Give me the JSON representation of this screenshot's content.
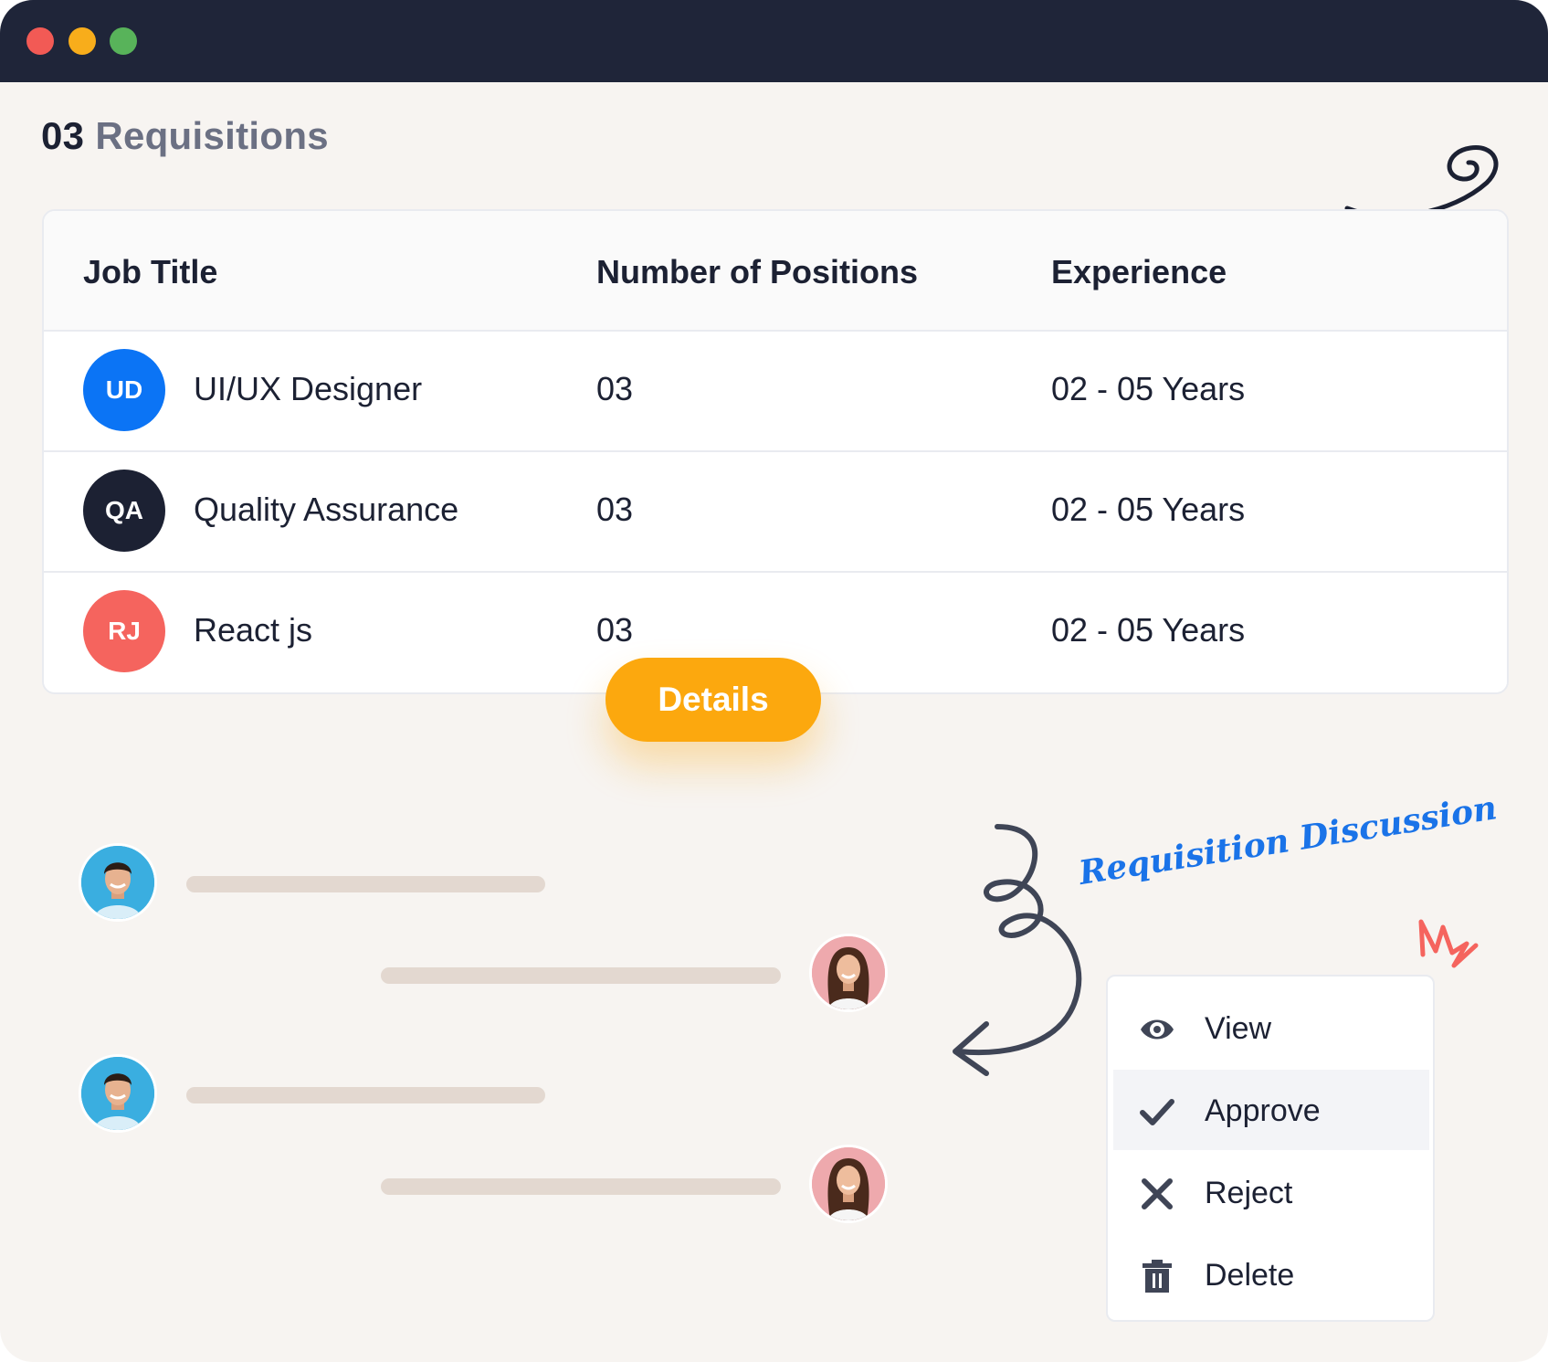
{
  "window": {
    "controls": [
      "close",
      "minimize",
      "maximize"
    ]
  },
  "page": {
    "count": "03",
    "title": "Requisitions"
  },
  "table": {
    "columns": [
      "Job Title",
      "Number of Positions",
      "Experience"
    ],
    "rows": [
      {
        "initials": "UD",
        "badge_color": "#0b74f5",
        "title": "UI/UX Designer",
        "positions": "03",
        "experience": "02 - 05 Years"
      },
      {
        "initials": "QA",
        "badge_color": "#1c2133",
        "title": "Quality Assurance",
        "positions": "03",
        "experience": "02 - 05 Years"
      },
      {
        "initials": "RJ",
        "badge_color": "#f5645e",
        "title": "React js",
        "positions": "03",
        "experience": "02 - 05 Years"
      }
    ]
  },
  "details_button": {
    "label": "Details",
    "color": "#fca80e"
  },
  "discussion": {
    "label": "Requisition Discussion"
  },
  "action_menu": {
    "items": [
      {
        "label": "View",
        "icon": "eye-icon"
      },
      {
        "label": "Approve",
        "icon": "check-icon",
        "active": true
      },
      {
        "label": "Reject",
        "icon": "close-icon"
      },
      {
        "label": "Delete",
        "icon": "trash-icon"
      }
    ]
  },
  "colors": {
    "titlebar": "#1f2539",
    "background": "#f7f4f1",
    "text_dark": "#1c2133",
    "accent_blue": "#1a73e8",
    "accent_orange": "#fca80e"
  }
}
